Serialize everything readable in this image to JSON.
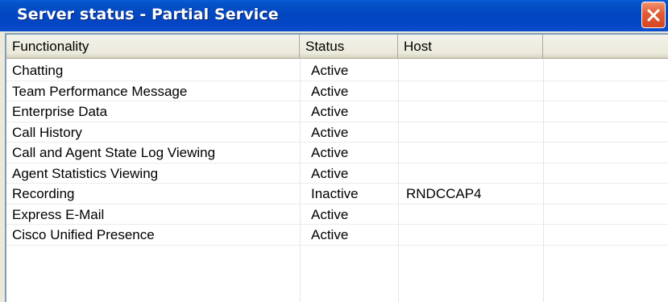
{
  "window": {
    "title": "Server status - Partial Service"
  },
  "table": {
    "headers": {
      "functionality": "Functionality",
      "status": "Status",
      "host": "Host",
      "extra": ""
    },
    "rows": [
      {
        "functionality": "Chatting",
        "status": "Active",
        "host": ""
      },
      {
        "functionality": "Team Performance Message",
        "status": "Active",
        "host": ""
      },
      {
        "functionality": "Enterprise Data",
        "status": "Active",
        "host": ""
      },
      {
        "functionality": "Call History",
        "status": "Active",
        "host": ""
      },
      {
        "functionality": "Call and Agent State Log Viewing",
        "status": "Active",
        "host": ""
      },
      {
        "functionality": "Agent Statistics Viewing",
        "status": "Active",
        "host": ""
      },
      {
        "functionality": "Recording",
        "status": "Inactive",
        "host": "RNDCCAP4"
      },
      {
        "functionality": "Express E-Mail",
        "status": "Active",
        "host": ""
      },
      {
        "functionality": "Cisco Unified Presence",
        "status": "Active",
        "host": ""
      }
    ]
  },
  "colors": {
    "titlebar": "#0347c0",
    "close_button": "#e35a32",
    "window_bg": "#ece9d8"
  },
  "icons": {
    "close": "close-icon"
  }
}
